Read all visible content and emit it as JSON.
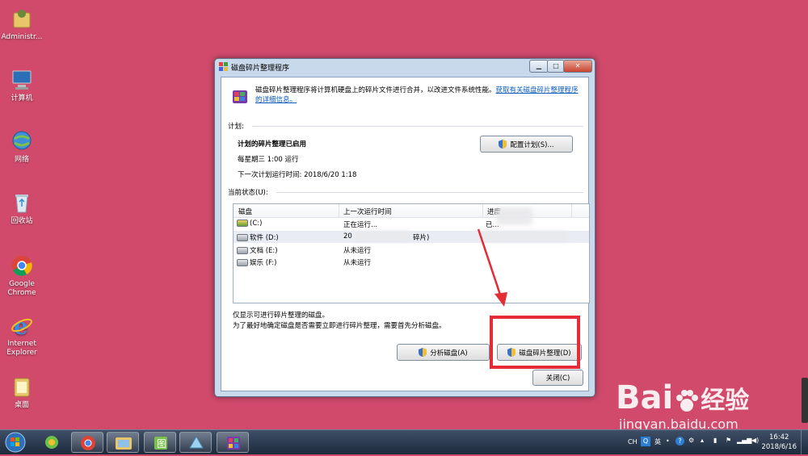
{
  "desktop": {
    "icons": [
      {
        "label": "Administr..."
      },
      {
        "label": "计算机"
      },
      {
        "label": "网络"
      },
      {
        "label": "回收站"
      },
      {
        "label": "Google Chrome"
      },
      {
        "label": "Internet Explorer"
      },
      {
        "label": "桌面"
      }
    ]
  },
  "window": {
    "title": "磁盘碎片整理程序",
    "intro_text": "磁盘碎片整理程序将计算机硬盘上的碎片文件进行合并，以改进文件系统性能。",
    "intro_link": "获取有关磁盘碎片整理程序的详细信息。",
    "schedule": {
      "section_label": "计划:",
      "enabled": "计划的碎片整理已启用",
      "frequency": "每星期三  1:00 运行",
      "next_run": "下一次计划运行时间: 2018/6/20 1:18",
      "configure_button": "配置计划(S)..."
    },
    "status": {
      "section_label": "当前状态(U):",
      "columns": [
        "磁盘",
        "上一次运行时间",
        "进度"
      ],
      "rows": [
        {
          "disk": "(C:)",
          "last_run": "正在运行...",
          "progress": "已..."
        },
        {
          "disk": "软件 (D:)",
          "last_run": "20",
          "extra": "碎片)"
        },
        {
          "disk": "文档 (E:)",
          "last_run": "从未运行"
        },
        {
          "disk": "娱乐 (F:)",
          "last_run": "从未运行"
        }
      ]
    },
    "note_line1": "仅显示可进行碎片整理的磁盘。",
    "note_line2": "为了最好地确定磁盘是否需要立即进行碎片整理，需要首先分析磁盘。",
    "analyze_button": "分析磁盘(A)",
    "defrag_button": "磁盘碎片整理(D)",
    "close_button": "关闭(C)"
  },
  "taskbar": {
    "tray": {
      "lang": "CH",
      "ime": "英"
    },
    "clock_time": "16:42",
    "clock_date": "2018/6/16"
  },
  "watermark": {
    "brand": "Bai",
    "brand2": "经验",
    "url": "jingyan.baidu.com"
  },
  "colors": {
    "desktop_bg": "#d14a6c",
    "annotation_red": "#e52b36",
    "link_blue": "#0b5bbf"
  }
}
